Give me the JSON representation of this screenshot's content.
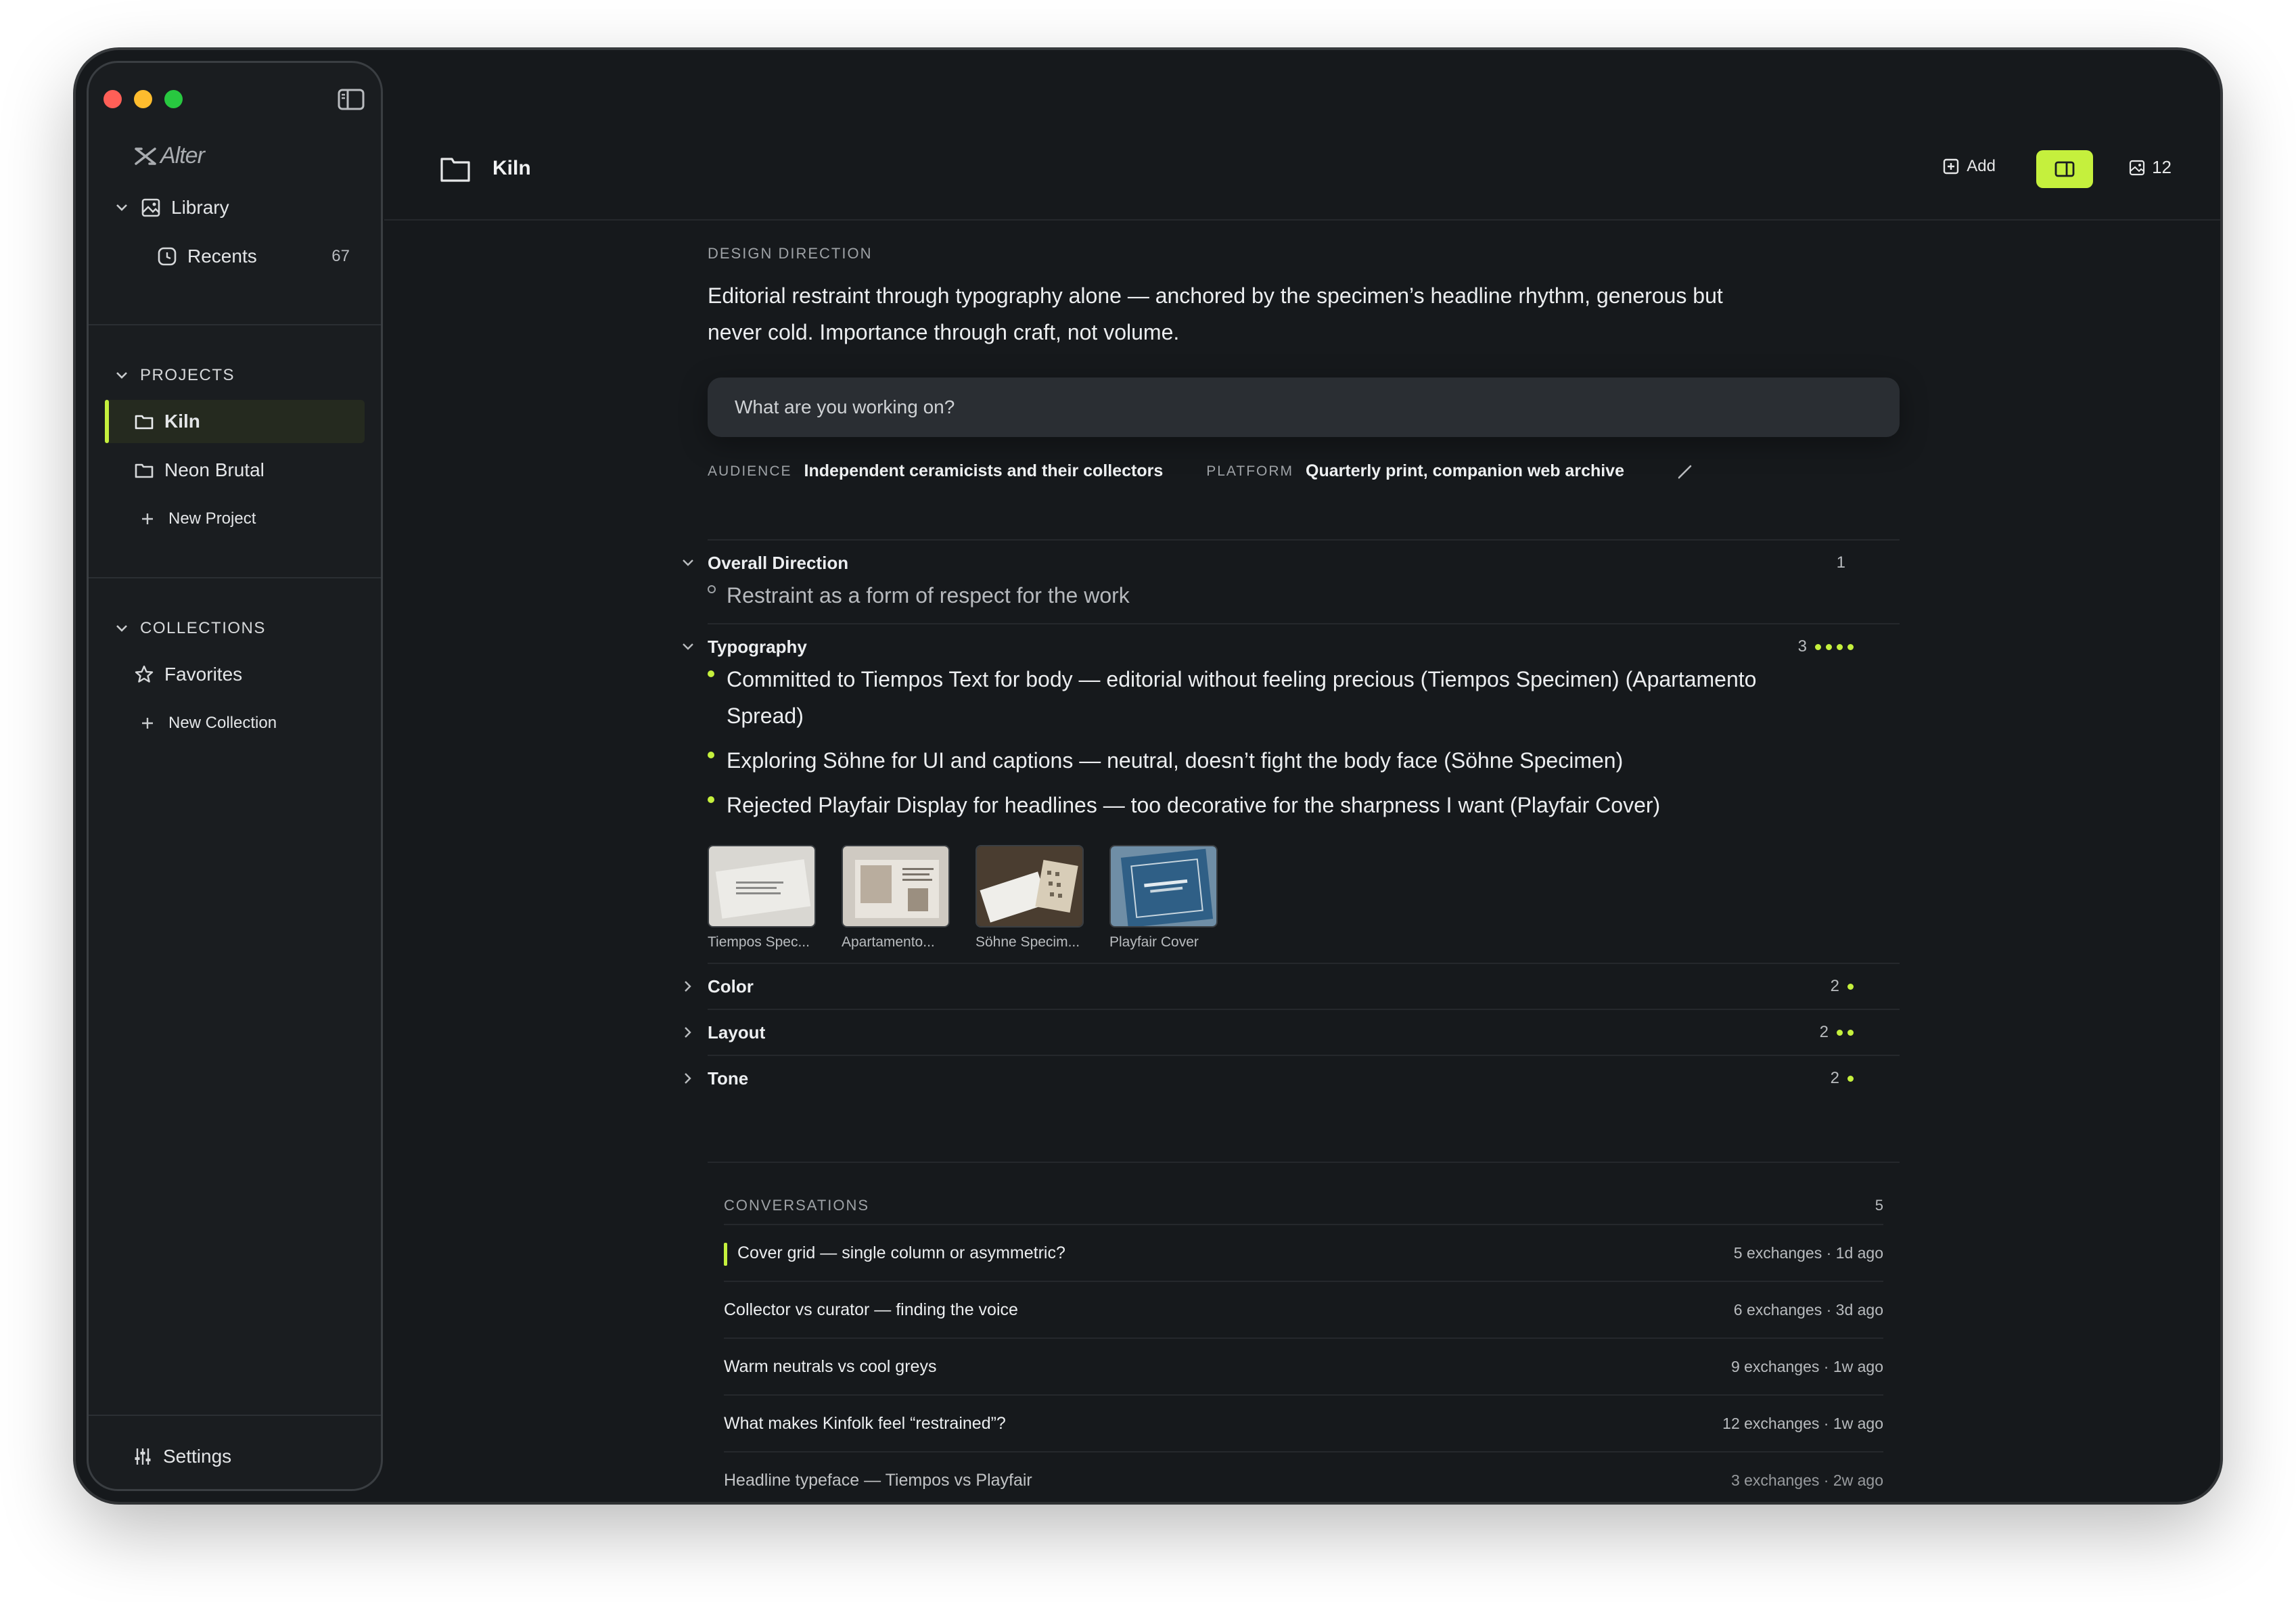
{
  "sidebar": {
    "logo": "Alter",
    "library": "Library",
    "recents": {
      "label": "Recents",
      "count": "67"
    },
    "projects_heading": "PROJECTS",
    "projects": [
      "Kiln",
      "Neon Brutal"
    ],
    "new_project": "New Project",
    "collections_heading": "COLLECTIONS",
    "favorites": "Favorites",
    "new_collection": "New Collection",
    "settings": "Settings"
  },
  "topbar": {
    "title": "Kiln",
    "add_label": "Add",
    "image_count": "12",
    "accent": "#c5f03d"
  },
  "direction": {
    "label": "DESIGN DIRECTION",
    "text": "Editorial restraint through typography alone — anchored by the specimen’s headline rhythm, generous but never cold. Importance through craft, not volume."
  },
  "ask": {
    "placeholder": "What are you working on?"
  },
  "meta": {
    "audience_label": "AUDIENCE",
    "audience": "Independent ceramicists and their collectors",
    "platform_label": "PLATFORM",
    "platform": "Quarterly print, companion web archive"
  },
  "sections": {
    "overall": {
      "title": "Overall Direction",
      "count": "1",
      "items": [
        "Restraint as a form of respect for the work"
      ]
    },
    "typography": {
      "title": "Typography",
      "count": "3",
      "dots": 4,
      "items": [
        "Committed to Tiempos Text for body — editorial without feeling precious (Tiempos Specimen) (Apartamento Spread)",
        "Exploring Söhne for UI and captions — neutral, doesn’t fight the body face (Söhne Specimen)",
        "Rejected Playfair Display for headlines — too decorative for the sharpness I want (Playfair Cover)"
      ],
      "thumbs": [
        "Tiempos Spec...",
        "Apartamento...",
        "Söhne Specim...",
        "Playfair Cover"
      ]
    },
    "color": {
      "title": "Color",
      "count": "2",
      "dots": 1
    },
    "layout": {
      "title": "Layout",
      "count": "2",
      "dots": 2
    },
    "tone": {
      "title": "Tone",
      "count": "2",
      "dots": 1
    }
  },
  "conversations": {
    "label": "CONVERSATIONS",
    "count": "5",
    "items": [
      {
        "title": "Cover grid — single column or asymmetric?",
        "meta": "5 exchanges · 1d ago"
      },
      {
        "title": "Collector vs curator — finding the voice",
        "meta": "6 exchanges · 3d ago"
      },
      {
        "title": "Warm neutrals vs cool greys",
        "meta": "9 exchanges · 1w ago"
      },
      {
        "title": "What makes Kinfolk feel “restrained”?",
        "meta": "12 exchanges · 1w ago"
      },
      {
        "title": "Headline typeface — Tiempos vs Playfair",
        "meta": "3 exchanges · 2w ago"
      }
    ]
  }
}
